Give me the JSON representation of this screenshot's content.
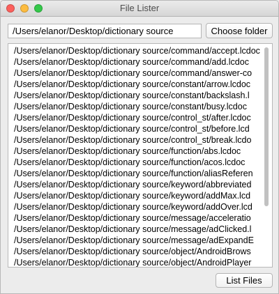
{
  "window": {
    "title": "File Lister",
    "controls": {
      "close_color": "#fc605c",
      "minimize_color": "#fdbc40",
      "zoom_color": "#34c84a"
    }
  },
  "folder": {
    "path_value": "/Users/elanor/Desktop/dictionary source",
    "choose_label": "Choose folder"
  },
  "files": [
    "/Users/elanor/Desktop/dictionary source/command/accept.lcdoc",
    "/Users/elanor/Desktop/dictionary source/command/add.lcdoc",
    "/Users/elanor/Desktop/dictionary source/command/answer-co",
    "/Users/elanor/Desktop/dictionary source/constant/arrow.lcdoc",
    "/Users/elanor/Desktop/dictionary source/constant/backslash.l",
    "/Users/elanor/Desktop/dictionary source/constant/busy.lcdoc",
    "/Users/elanor/Desktop/dictionary source/control_st/after.lcdoc",
    "/Users/elanor/Desktop/dictionary source/control_st/before.lcd",
    "/Users/elanor/Desktop/dictionary source/control_st/break.lcdo",
    "/Users/elanor/Desktop/dictionary source/function/abs.lcdoc",
    "/Users/elanor/Desktop/dictionary source/function/acos.lcdoc",
    "/Users/elanor/Desktop/dictionary source/function/aliasReferen",
    "/Users/elanor/Desktop/dictionary source/keyword/abbreviated",
    "/Users/elanor/Desktop/dictionary source/keyword/addMax.lcd",
    "/Users/elanor/Desktop/dictionary source/keyword/addOver.lcd",
    "/Users/elanor/Desktop/dictionary source/message/acceleratio",
    "/Users/elanor/Desktop/dictionary source/message/adClicked.l",
    "/Users/elanor/Desktop/dictionary source/message/adExpandE",
    "/Users/elanor/Desktop/dictionary source/object/AndroidBrows",
    "/Users/elanor/Desktop/dictionary source/object/AndroidPlayer"
  ],
  "actions": {
    "list_files_label": "List Files"
  }
}
